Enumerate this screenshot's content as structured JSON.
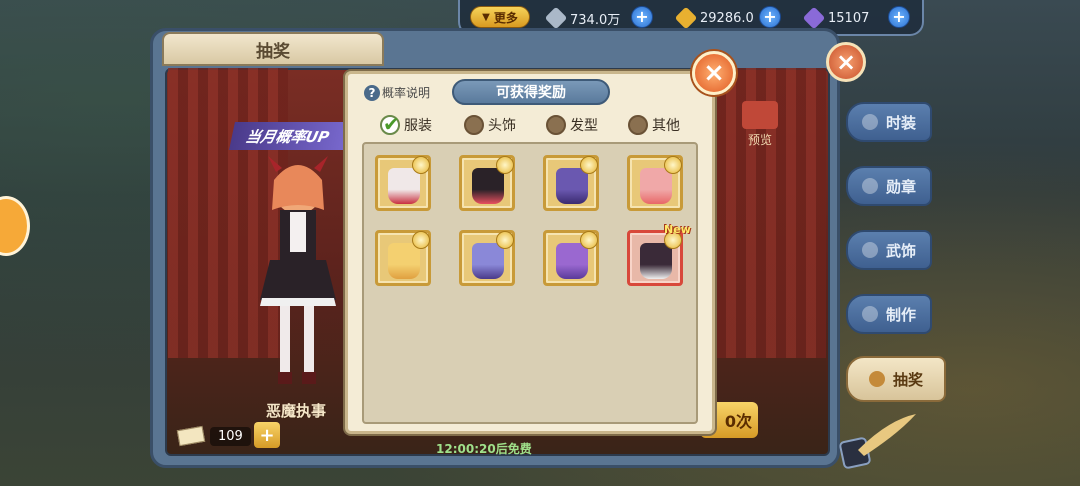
{
  "resources": {
    "more_label": "更多",
    "items": [
      {
        "icon": "feather-icon",
        "value": "734.0万",
        "color": "#aab8c8"
      },
      {
        "icon": "leaf-coin-icon",
        "value": "29286.0",
        "color": "#e8b030"
      },
      {
        "icon": "gem-icon",
        "value": "15107",
        "color": "#8a6ad8"
      }
    ],
    "plus_label": "+"
  },
  "book": {
    "title": "抽奖",
    "banner": "当月概率UP",
    "character_name": "恶魔执事",
    "ticket_count": "109",
    "ticket_plus": "+",
    "times_label": "0次",
    "free_timer": "12:00:20后免费",
    "preview_label": "预览",
    "close_label": "×"
  },
  "side_tabs": [
    {
      "label": "时装",
      "icon": "dress-icon",
      "active": false
    },
    {
      "label": "勋章",
      "icon": "medal-icon",
      "active": false
    },
    {
      "label": "武饰",
      "icon": "horn-icon",
      "active": false
    },
    {
      "label": "制作",
      "icon": "craft-icon",
      "active": false
    },
    {
      "label": "抽奖",
      "icon": "lottery-horn-icon",
      "active": true
    }
  ],
  "modal": {
    "title": "可获得奖励",
    "help_label": "概率说明",
    "close_label": "×",
    "filters": [
      {
        "label": "服装",
        "checked": true
      },
      {
        "label": "头饰",
        "checked": false
      },
      {
        "label": "发型",
        "checked": false
      },
      {
        "label": "其他",
        "checked": false
      }
    ],
    "items": [
      {
        "name": "outfit-white-red",
        "color": "#f0e8e8",
        "accent": "#c83040",
        "new": false
      },
      {
        "name": "outfit-black-maid",
        "color": "#2a2228",
        "accent": "#e85060",
        "new": false
      },
      {
        "name": "outfit-purple-gown",
        "color": "#6a58b0",
        "accent": "#3a2a70",
        "new": false
      },
      {
        "name": "outfit-pink-dress",
        "color": "#f0a8a8",
        "accent": "#e86868",
        "new": false
      },
      {
        "name": "outfit-yellow-robe",
        "color": "#f4d070",
        "accent": "#e0a040",
        "new": false
      },
      {
        "name": "outfit-purple-knight",
        "color": "#8a88d8",
        "accent": "#4a3a8a",
        "new": false
      },
      {
        "name": "outfit-violet-gown",
        "color": "#9a68d0",
        "accent": "#5a3a9a",
        "new": false
      },
      {
        "name": "outfit-demon-maid",
        "color": "#3a2a38",
        "accent": "#f0f0f0",
        "new": true
      }
    ],
    "new_tag": "New"
  }
}
